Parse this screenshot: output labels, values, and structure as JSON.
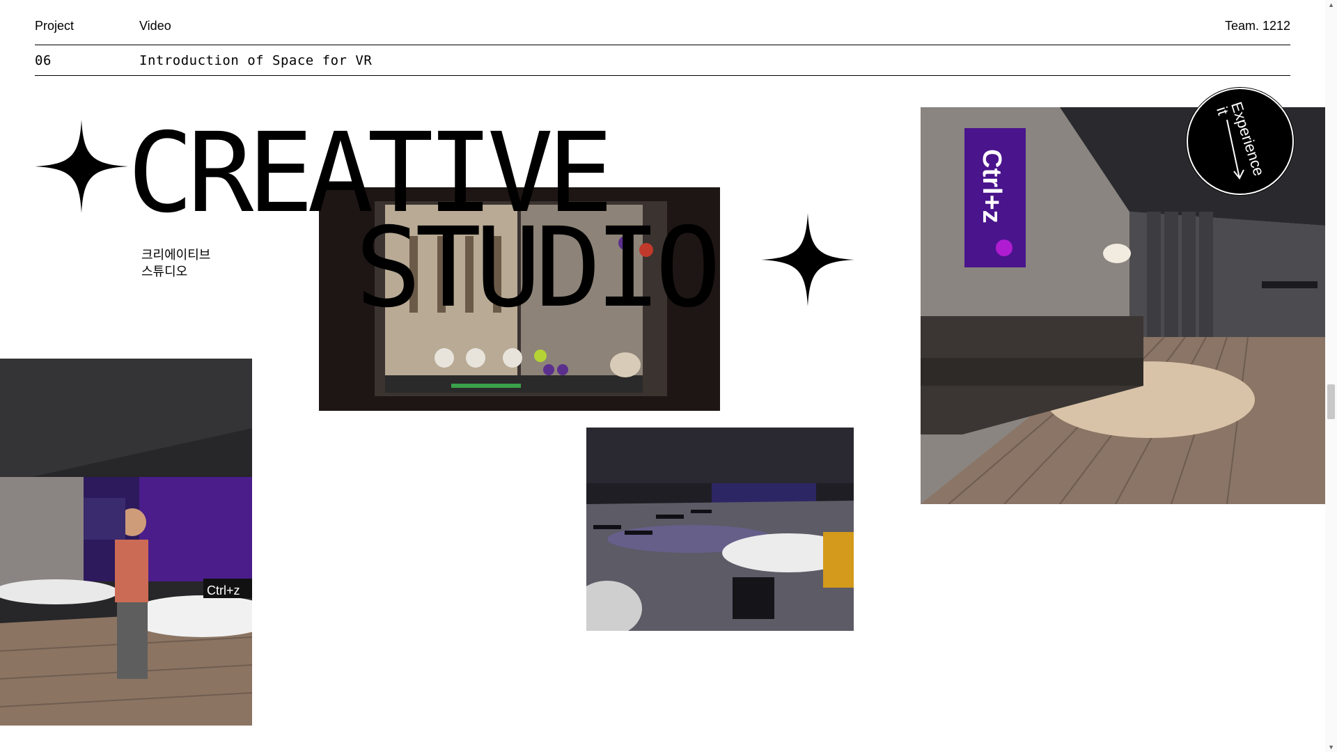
{
  "header": {
    "project_label": "Project",
    "video_label": "Video",
    "team_label": "Team. 1212",
    "project_number": "06",
    "project_title": "Introduction of Space for VR"
  },
  "hero": {
    "line1": "CREATIVE",
    "line2": "STUDIO",
    "korean_line1": "크리에이티브",
    "korean_line2": "스튜디오"
  },
  "badge": {
    "line1": "Experience",
    "line2": "it"
  },
  "images": {
    "top_right_poster": "Ctrl+z",
    "bottom_left_screen": "Ctrl+z"
  },
  "colors": {
    "accent": "#000000",
    "poster_purple": "#4a148c"
  }
}
